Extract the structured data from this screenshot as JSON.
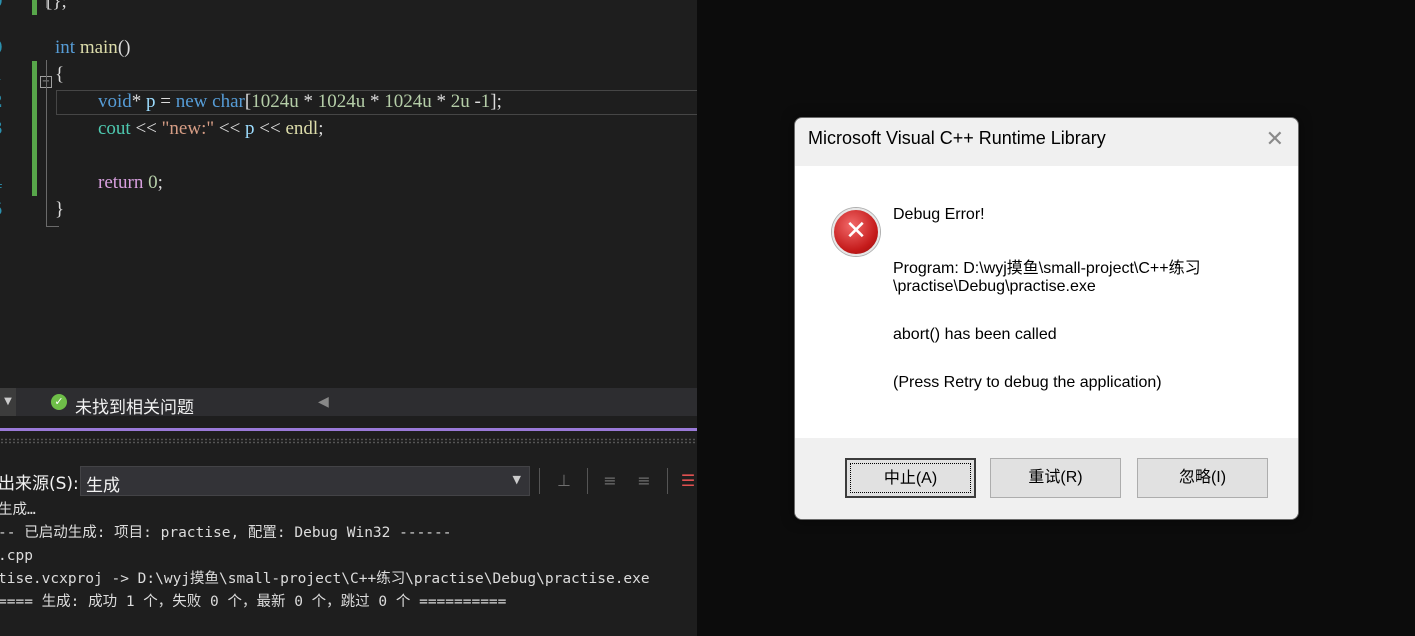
{
  "editor": {
    "line_numbers": [
      "9",
      "0",
      "1",
      "2",
      "3",
      "4",
      "5",
      "6"
    ],
    "lines": {
      "top_brace": "[};",
      "main_kw": "int",
      "main_name": "main",
      "main_parens": "()",
      "open_brace": "{",
      "l1_type": "void",
      "l1_a": "* ",
      "l1_var": "p",
      "l1_b": " = ",
      "l1_new": "new",
      "l1_sp": " ",
      "l1_char": "char",
      "l1_c": "[",
      "l1_n1": "1024u",
      "l1_m1": " * ",
      "l1_n2": "1024u",
      "l1_m2": " * ",
      "l1_n3": "1024u",
      "l1_m3": " * ",
      "l1_n4": "2u",
      "l1_m4": " -",
      "l1_n5": "1",
      "l1_d": "];",
      "l2_cout": "cout",
      "l2_a": " << ",
      "l2_str": "\"new:\"",
      "l2_b": " << ",
      "l2_var": "p",
      "l2_c": " << ",
      "l2_endl": "endl",
      "l2_d": ";",
      "l3_ret": "return",
      "l3_sp": " ",
      "l3_zero": "0",
      "l3_semi": ";",
      "close_brace": "}"
    }
  },
  "status": {
    "issues_text": "未找到相关问题"
  },
  "output_panel": {
    "source_label": "出来源(S):",
    "source_value": "生成",
    "lines": [
      "生成…",
      "-- 已启动生成: 项目: practise, 配置: Debug Win32 ------",
      ".cpp",
      "tise.vcxproj -> D:\\wyj摸鱼\\small-project\\C++练习\\practise\\Debug\\practise.exe",
      "==== 生成: 成功 1 个，失败 0 个，最新 0 个，跳过 0 个 =========="
    ]
  },
  "dialog": {
    "title": "Microsoft Visual C++ Runtime Library",
    "close_glyph": "✕",
    "heading": "Debug Error!",
    "program_line1": "Program: D:\\wyj摸鱼\\small-project\\C++练习",
    "program_line2": "\\practise\\Debug\\practise.exe",
    "message": "abort() has been called",
    "hint": "(Press Retry to debug the application)",
    "icon": "error-x-icon",
    "buttons": {
      "abort": "中止(A)",
      "retry": "重试(R)",
      "ignore": "忽略(I)"
    }
  }
}
